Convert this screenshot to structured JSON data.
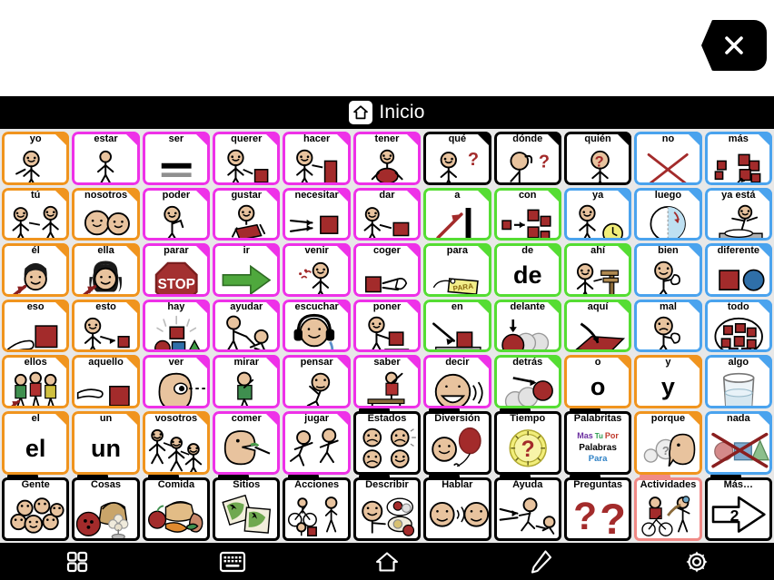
{
  "window": {
    "close_label": "×"
  },
  "header": {
    "title": "Inicio",
    "home_icon": "home-icon"
  },
  "palette": {
    "orange": "#F0941E",
    "magenta": "#EE31E8",
    "black": "#000000",
    "blue": "#4AA3EE",
    "green": "#55DD33",
    "highlight_red": "#F08A86",
    "board_bg": "#E8E8E8",
    "bar_bg": "#000000"
  },
  "board": {
    "columns": 11,
    "rows": 7,
    "cells": [
      {
        "label": "yo",
        "color": "#F0941E",
        "art": "person-pointing-self",
        "kind": "symbol"
      },
      {
        "label": "estar",
        "color": "#EE31E8",
        "art": "person-standing",
        "kind": "symbol"
      },
      {
        "label": "ser",
        "color": "#EE31E8",
        "art": "equals-bars",
        "kind": "symbol"
      },
      {
        "label": "querer",
        "color": "#EE31E8",
        "art": "person-reaching-block",
        "kind": "symbol"
      },
      {
        "label": "hacer",
        "color": "#EE31E8",
        "art": "person-building-block",
        "kind": "symbol"
      },
      {
        "label": "tener",
        "color": "#EE31E8",
        "art": "person-holding-block",
        "kind": "symbol"
      },
      {
        "label": "qué",
        "color": "#000000",
        "art": "person-question",
        "kind": "symbol"
      },
      {
        "label": "dónde",
        "color": "#000000",
        "art": "person-looking-question",
        "kind": "symbol"
      },
      {
        "label": "quién",
        "color": "#000000",
        "art": "person-face-question",
        "kind": "symbol"
      },
      {
        "label": "no",
        "color": "#4AA3EE",
        "art": "red-x-cross",
        "kind": "symbol"
      },
      {
        "label": "más",
        "color": "#4AA3EE",
        "art": "blocks-pile-arrow",
        "kind": "symbol"
      },
      {
        "label": "tú",
        "color": "#F0941E",
        "art": "two-people-pointing",
        "kind": "symbol"
      },
      {
        "label": "nosotros",
        "color": "#F0941E",
        "art": "two-heads",
        "kind": "symbol"
      },
      {
        "label": "poder",
        "color": "#EE31E8",
        "art": "person-flexing",
        "kind": "symbol"
      },
      {
        "label": "gustar",
        "color": "#EE31E8",
        "art": "person-hugging-block",
        "kind": "symbol"
      },
      {
        "label": "necesitar",
        "color": "#EE31E8",
        "art": "hands-reaching-block",
        "kind": "symbol"
      },
      {
        "label": "dar",
        "color": "#EE31E8",
        "art": "person-giving-block",
        "kind": "symbol"
      },
      {
        "label": "a",
        "color": "#55DD33",
        "art": "arrow-to-bar",
        "kind": "symbol"
      },
      {
        "label": "con",
        "color": "#55DD33",
        "art": "blocks-joining",
        "kind": "symbol"
      },
      {
        "label": "ya",
        "color": "#4AA3EE",
        "art": "person-with-clock",
        "kind": "symbol"
      },
      {
        "label": "luego",
        "color": "#4AA3EE",
        "art": "clock-half-shaded",
        "kind": "symbol"
      },
      {
        "label": "ya está",
        "color": "#4AA3EE",
        "art": "person-hands-up-table",
        "kind": "symbol"
      },
      {
        "label": "él",
        "color": "#F0941E",
        "art": "boy-head-arrow",
        "kind": "symbol"
      },
      {
        "label": "ella",
        "color": "#F0941E",
        "art": "girl-head-arrow",
        "kind": "symbol"
      },
      {
        "label": "parar",
        "color": "#EE31E8",
        "art": "stop-sign",
        "kind": "symbol"
      },
      {
        "label": "ir",
        "color": "#EE31E8",
        "art": "green-arrow-right",
        "kind": "symbol"
      },
      {
        "label": "venir",
        "color": "#EE31E8",
        "art": "person-beckoning",
        "kind": "symbol"
      },
      {
        "label": "coger",
        "color": "#EE31E8",
        "art": "hand-taking-block",
        "kind": "symbol"
      },
      {
        "label": "para",
        "color": "#55DD33",
        "art": "yellow-tag-para",
        "kind": "symbol"
      },
      {
        "label": "de",
        "color": "#55DD33",
        "art": "",
        "kind": "word",
        "word": "de"
      },
      {
        "label": "ahí",
        "color": "#55DD33",
        "art": "person-pointing-signpost",
        "kind": "symbol"
      },
      {
        "label": "bien",
        "color": "#4AA3EE",
        "art": "person-thumbs-up",
        "kind": "symbol"
      },
      {
        "label": "diferente",
        "color": "#4AA3EE",
        "art": "square-and-circle",
        "kind": "symbol"
      },
      {
        "label": "eso",
        "color": "#F0941E",
        "art": "hand-pointing-big-block",
        "kind": "symbol"
      },
      {
        "label": "esto",
        "color": "#F0941E",
        "art": "person-pointing-small-block",
        "kind": "symbol"
      },
      {
        "label": "hay",
        "color": "#EE31E8",
        "art": "shining-block-shapes",
        "kind": "symbol"
      },
      {
        "label": "ayudar",
        "color": "#EE31E8",
        "art": "person-helping-person",
        "kind": "symbol"
      },
      {
        "label": "escuchar",
        "color": "#EE31E8",
        "art": "person-headphones",
        "kind": "symbol"
      },
      {
        "label": "poner",
        "color": "#EE31E8",
        "art": "person-placing-block",
        "kind": "symbol"
      },
      {
        "label": "en",
        "color": "#55DD33",
        "art": "arrow-onto-block",
        "kind": "symbol"
      },
      {
        "label": "delante",
        "color": "#55DD33",
        "art": "balls-front",
        "kind": "symbol"
      },
      {
        "label": "aquí",
        "color": "#55DD33",
        "art": "arrow-onto-red-plane",
        "kind": "symbol"
      },
      {
        "label": "mal",
        "color": "#4AA3EE",
        "art": "person-thumbs-down",
        "kind": "symbol"
      },
      {
        "label": "todo",
        "color": "#4AA3EE",
        "art": "blocks-in-circle",
        "kind": "symbol"
      },
      {
        "label": "ellos",
        "color": "#F0941E",
        "art": "group-people-arrow",
        "kind": "symbol"
      },
      {
        "label": "aquello",
        "color": "#F0941E",
        "art": "hand-pointing-block-far",
        "kind": "symbol"
      },
      {
        "label": "ver",
        "color": "#EE31E8",
        "art": "eye-profile-sightline",
        "kind": "symbol"
      },
      {
        "label": "mirar",
        "color": "#EE31E8",
        "art": "person-looking",
        "kind": "symbol"
      },
      {
        "label": "pensar",
        "color": "#EE31E8",
        "art": "person-thinking",
        "kind": "symbol"
      },
      {
        "label": "saber",
        "color": "#EE31E8",
        "art": "person-raising-hand-desk",
        "kind": "symbol"
      },
      {
        "label": "decir",
        "color": "#EE31E8",
        "art": "face-speaking",
        "kind": "symbol"
      },
      {
        "label": "detrás",
        "color": "#55DD33",
        "art": "balls-behind",
        "kind": "symbol"
      },
      {
        "label": "o",
        "color": "#F0941E",
        "art": "",
        "kind": "word",
        "word": "o"
      },
      {
        "label": "y",
        "color": "#F0941E",
        "art": "",
        "kind": "word",
        "word": "y"
      },
      {
        "label": "algo",
        "color": "#4AA3EE",
        "art": "glass-half-full",
        "kind": "symbol"
      },
      {
        "label": "el",
        "color": "#F0941E",
        "art": "",
        "kind": "word",
        "word": "el"
      },
      {
        "label": "un",
        "color": "#F0941E",
        "art": "",
        "kind": "word",
        "word": "un"
      },
      {
        "label": "vosotros",
        "color": "#F0941E",
        "art": "three-people-pointing",
        "kind": "symbol"
      },
      {
        "label": "comer",
        "color": "#EE31E8",
        "art": "face-eating-fork",
        "kind": "symbol"
      },
      {
        "label": "jugar",
        "color": "#EE31E8",
        "art": "two-people-running",
        "kind": "symbol"
      },
      {
        "label": "Estados",
        "color": "#000000",
        "art": "four-mood-faces",
        "kind": "folder"
      },
      {
        "label": "Diversión",
        "color": "#000000",
        "art": "face-with-balloon",
        "kind": "folder"
      },
      {
        "label": "Tiempo",
        "color": "#000000",
        "art": "clock-question",
        "kind": "folder"
      },
      {
        "label": "Palabritas",
        "color": "#000000",
        "art": "palabritas-words",
        "kind": "folder"
      },
      {
        "label": "porque",
        "color": "#F0941E",
        "art": "speech-bubbles-question",
        "kind": "symbol"
      },
      {
        "label": "nada",
        "color": "#4AA3EE",
        "art": "shapes-crossed-out",
        "kind": "symbol"
      },
      {
        "label": "Gente",
        "color": "#000000",
        "art": "group-of-heads",
        "kind": "folder"
      },
      {
        "label": "Cosas",
        "color": "#000000",
        "art": "basket-ball-flower",
        "kind": "folder"
      },
      {
        "label": "Comida",
        "color": "#000000",
        "art": "bread-apple-carrot",
        "kind": "folder"
      },
      {
        "label": "Sitios",
        "color": "#000000",
        "art": "two-maps",
        "kind": "folder"
      },
      {
        "label": "Acciones",
        "color": "#000000",
        "art": "bike-walk-play",
        "kind": "folder"
      },
      {
        "label": "Describir",
        "color": "#000000",
        "art": "person-describing-items",
        "kind": "folder"
      },
      {
        "label": "Hablar",
        "color": "#000000",
        "art": "two-faces-talking",
        "kind": "folder"
      },
      {
        "label": "Ayuda",
        "color": "#000000",
        "art": "hands-helping-person",
        "kind": "folder"
      },
      {
        "label": "Preguntas",
        "color": "#000000",
        "art": "two-question-marks",
        "kind": "folder"
      },
      {
        "label": "Actividades",
        "color": "#F08A86",
        "art": "bike-and-activities",
        "kind": "folder",
        "highlight": true
      },
      {
        "label": "Más…",
        "color": "#000000",
        "art": "arrow-right-page-2",
        "kind": "folder_plain",
        "page": "2"
      }
    ]
  },
  "palabritas": {
    "w1": "Mas",
    "w2": "Tu",
    "w3": "Por",
    "w4": "Palabras",
    "w5": "Para"
  },
  "more_page_number": "2",
  "toolbar": {
    "items": [
      {
        "name": "grid-icon",
        "label": "Cuadrícula"
      },
      {
        "name": "keyboard-icon",
        "label": "Teclado"
      },
      {
        "name": "home-icon",
        "label": "Inicio"
      },
      {
        "name": "pencil-icon",
        "label": "Editar"
      },
      {
        "name": "gear-icon",
        "label": "Ajustes"
      }
    ]
  }
}
